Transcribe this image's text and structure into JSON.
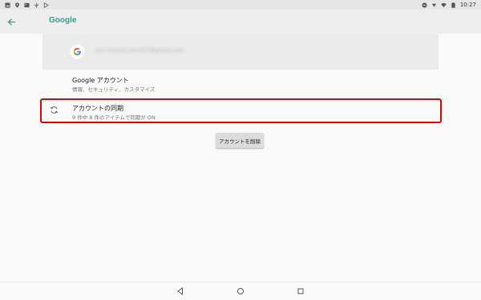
{
  "status_bar": {
    "time": "10:27",
    "left_icons": [
      "photo-icon",
      "location-icon",
      "image-icon",
      "usb-icon",
      "play-store-icon"
    ],
    "right_icons": [
      "do-not-disturb-icon",
      "signal-icon",
      "wifi-icon",
      "battery-icon"
    ]
  },
  "app_bar": {
    "title": "Google",
    "back_icon": "arrow-back-icon",
    "accent_color": "#2f9e8f"
  },
  "account": {
    "email": "xxx.xxxxxx.xxxx07@gmail.com"
  },
  "items": [
    {
      "title": "Google アカウント",
      "subtitle": "情報、セキュリティ、カスタマイズ"
    },
    {
      "icon": "sync-icon",
      "title": "アカウントの同期",
      "subtitle": "9 件中 8 件のアイテムで同期が ON"
    }
  ],
  "remove_button": "アカウントを削除",
  "highlight_color": "#e00000",
  "nav_bar": {
    "icons": [
      "nav-back-icon",
      "nav-home-icon",
      "nav-recents-icon"
    ]
  }
}
